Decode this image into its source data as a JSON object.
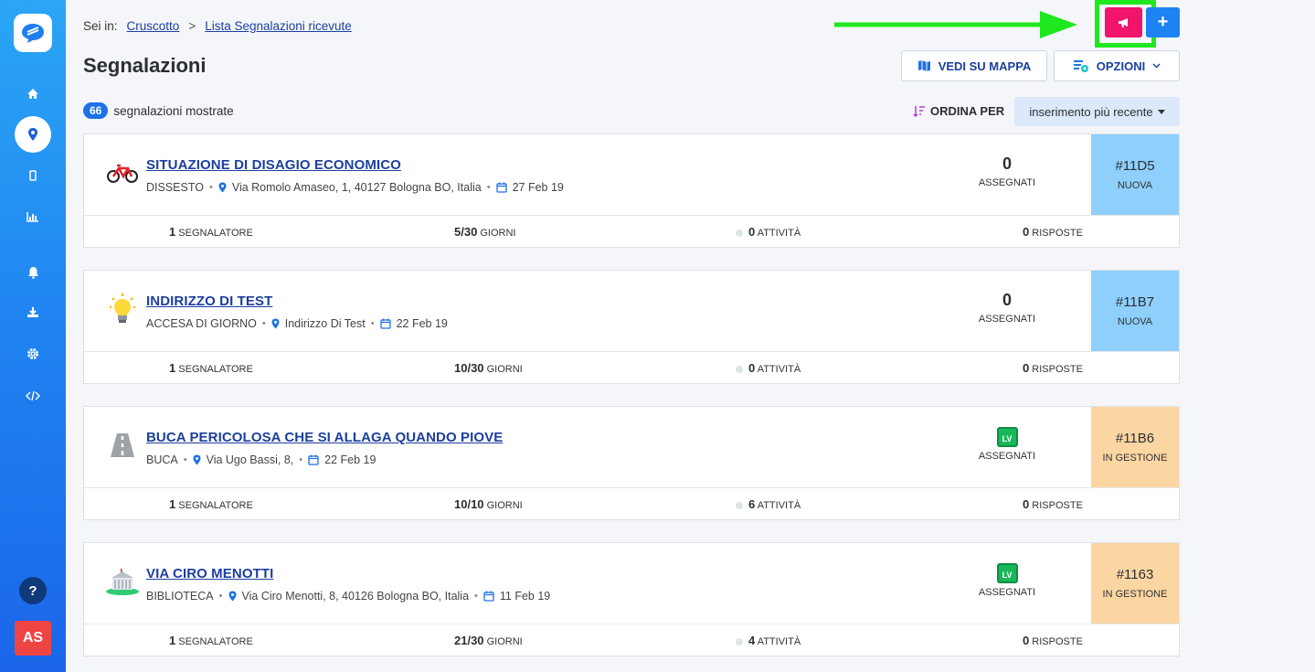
{
  "breadcrumb": {
    "prefix": "Sei in:",
    "items": [
      "Cruscotto",
      "Lista Segnalazioni ricevute"
    ],
    "separator": ">"
  },
  "page_title": "Segnalazioni",
  "toolbar": {
    "map_label": "VEDI SU MAPPA",
    "options_label": "OPZIONI",
    "plus_label": "+"
  },
  "summary": {
    "count": "66",
    "label": "segnalazioni mostrate"
  },
  "sort": {
    "label": "ORDINA PER",
    "value": "inserimento più recente"
  },
  "sidebar": {
    "help": "?",
    "avatar": "AS"
  },
  "colors": {
    "accent": "#1d82f2",
    "highlight": "#1ee81e",
    "megaphone": "#f0146a",
    "new": "#8ed0fb",
    "in_progress": "#fbd6a3"
  },
  "reports": [
    {
      "icon": "bicycle-icon",
      "title": "SITUAZIONE DI DISAGIO ECONOMICO",
      "category": "DISSESTO",
      "address": "Via Romolo Amaseo, 1, 40127 Bologna BO, Italia",
      "date": "27 Feb 19",
      "assigned_count": "0",
      "assigned_label": "ASSEGNATI",
      "assignee_badge": "",
      "code": "#11D5",
      "state": "NUOVA",
      "reporters": "1",
      "reporters_label": "SEGNALATORE",
      "days": "5/30",
      "days_label": "GIORNI",
      "activities": "0",
      "activities_label": "ATTIVITÀ",
      "replies": "0",
      "replies_label": "RISPOSTE"
    },
    {
      "icon": "lightbulb-icon",
      "title": "INDIRIZZO DI TEST",
      "category": "ACCESA DI GIORNO",
      "address": "Indirizzo Di Test",
      "date": "22 Feb 19",
      "assigned_count": "0",
      "assigned_label": "ASSEGNATI",
      "assignee_badge": "",
      "code": "#11B7",
      "state": "NUOVA",
      "reporters": "1",
      "reporters_label": "SEGNALATORE",
      "days": "10/30",
      "days_label": "GIORNI",
      "activities": "0",
      "activities_label": "ATTIVITÀ",
      "replies": "0",
      "replies_label": "RISPOSTE"
    },
    {
      "icon": "road-icon",
      "title": "BUCA PERICOLOSA CHE SI ALLAGA QUANDO PIOVE",
      "category": "BUCA",
      "address": "Via Ugo Bassi, 8,",
      "date": "22 Feb 19",
      "assigned_count": "",
      "assigned_label": "ASSEGNATI",
      "assignee_badge": "LV",
      "code": "#11B6",
      "state": "IN GESTIONE",
      "reporters": "1",
      "reporters_label": "SEGNALATORE",
      "days": "10/10",
      "days_label": "GIORNI",
      "activities": "6",
      "activities_label": "ATTIVITÀ",
      "replies": "0",
      "replies_label": "RISPOSTE"
    },
    {
      "icon": "library-icon",
      "title": "VIA CIRO MENOTTI",
      "category": "BIBLIOTECA",
      "address": "Via Ciro Menotti, 8, 40126 Bologna BO, Italia",
      "date": "11 Feb 19",
      "assigned_count": "",
      "assigned_label": "ASSEGNATI",
      "assignee_badge": "LV",
      "code": "#1163",
      "state": "IN GESTIONE",
      "reporters": "1",
      "reporters_label": "SEGNALATORE",
      "days": "21/30",
      "days_label": "GIORNI",
      "activities": "4",
      "activities_label": "ATTIVITÀ",
      "replies": "0",
      "replies_label": "RISPOSTE"
    }
  ]
}
